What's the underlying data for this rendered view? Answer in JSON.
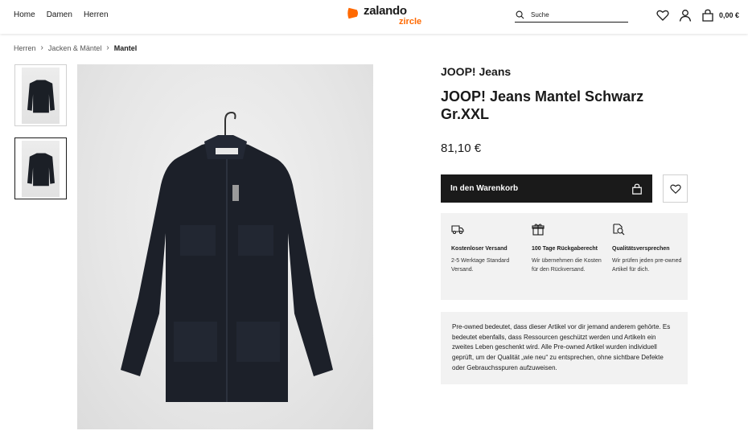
{
  "header": {
    "nav": [
      "Home",
      "Damen",
      "Herren"
    ],
    "logo": {
      "word": "zalando",
      "sub": "zircle",
      "accent": "#ff6900"
    },
    "search_placeholder": "Suche",
    "icons": [
      "search-icon",
      "heart-icon",
      "user-icon",
      "bag-icon"
    ],
    "cart_total": "0,00 €"
  },
  "breadcrumb": {
    "items": [
      "Herren",
      "Jacken & Mäntel"
    ],
    "current": "Mantel"
  },
  "product": {
    "brand": "JOOP! Jeans",
    "title": "JOOP! Jeans Mantel Schwarz Gr.XXL",
    "price": "81,10 €",
    "add_to_cart": "In den Warenkorb"
  },
  "benefits": [
    {
      "icon": "truck-icon",
      "title": "Kostenloser Versand",
      "desc": "2-5 Werktage Standard Versand."
    },
    {
      "icon": "gift-icon",
      "title": "100 Tage Rückgaberecht",
      "desc": "Wir übernehmen die Kosten für den Rückversand."
    },
    {
      "icon": "quality-icon",
      "title": "Qualitätsversprechen",
      "desc": "Wir prüfen jeden pre-owned Artikel für dich."
    }
  ],
  "preowned_text": "Pre-owned bedeutet, dass dieser Artikel vor dir jemand anderem gehörte. Es bedeutet ebenfalls, dass Ressourcen geschützt werden und Artikeln ein zweites Leben geschenkt wird. Alle Pre-owned Artikel wurden individuell geprüft, um der Qualität „wie neu“ zu entsprechen, ohne sichtbare Defekte oder Gebrauchsspuren aufzuweisen.",
  "colors": {
    "primary": "#1a1a1a",
    "panel": "#f2f2f2",
    "accent": "#ff6900"
  }
}
